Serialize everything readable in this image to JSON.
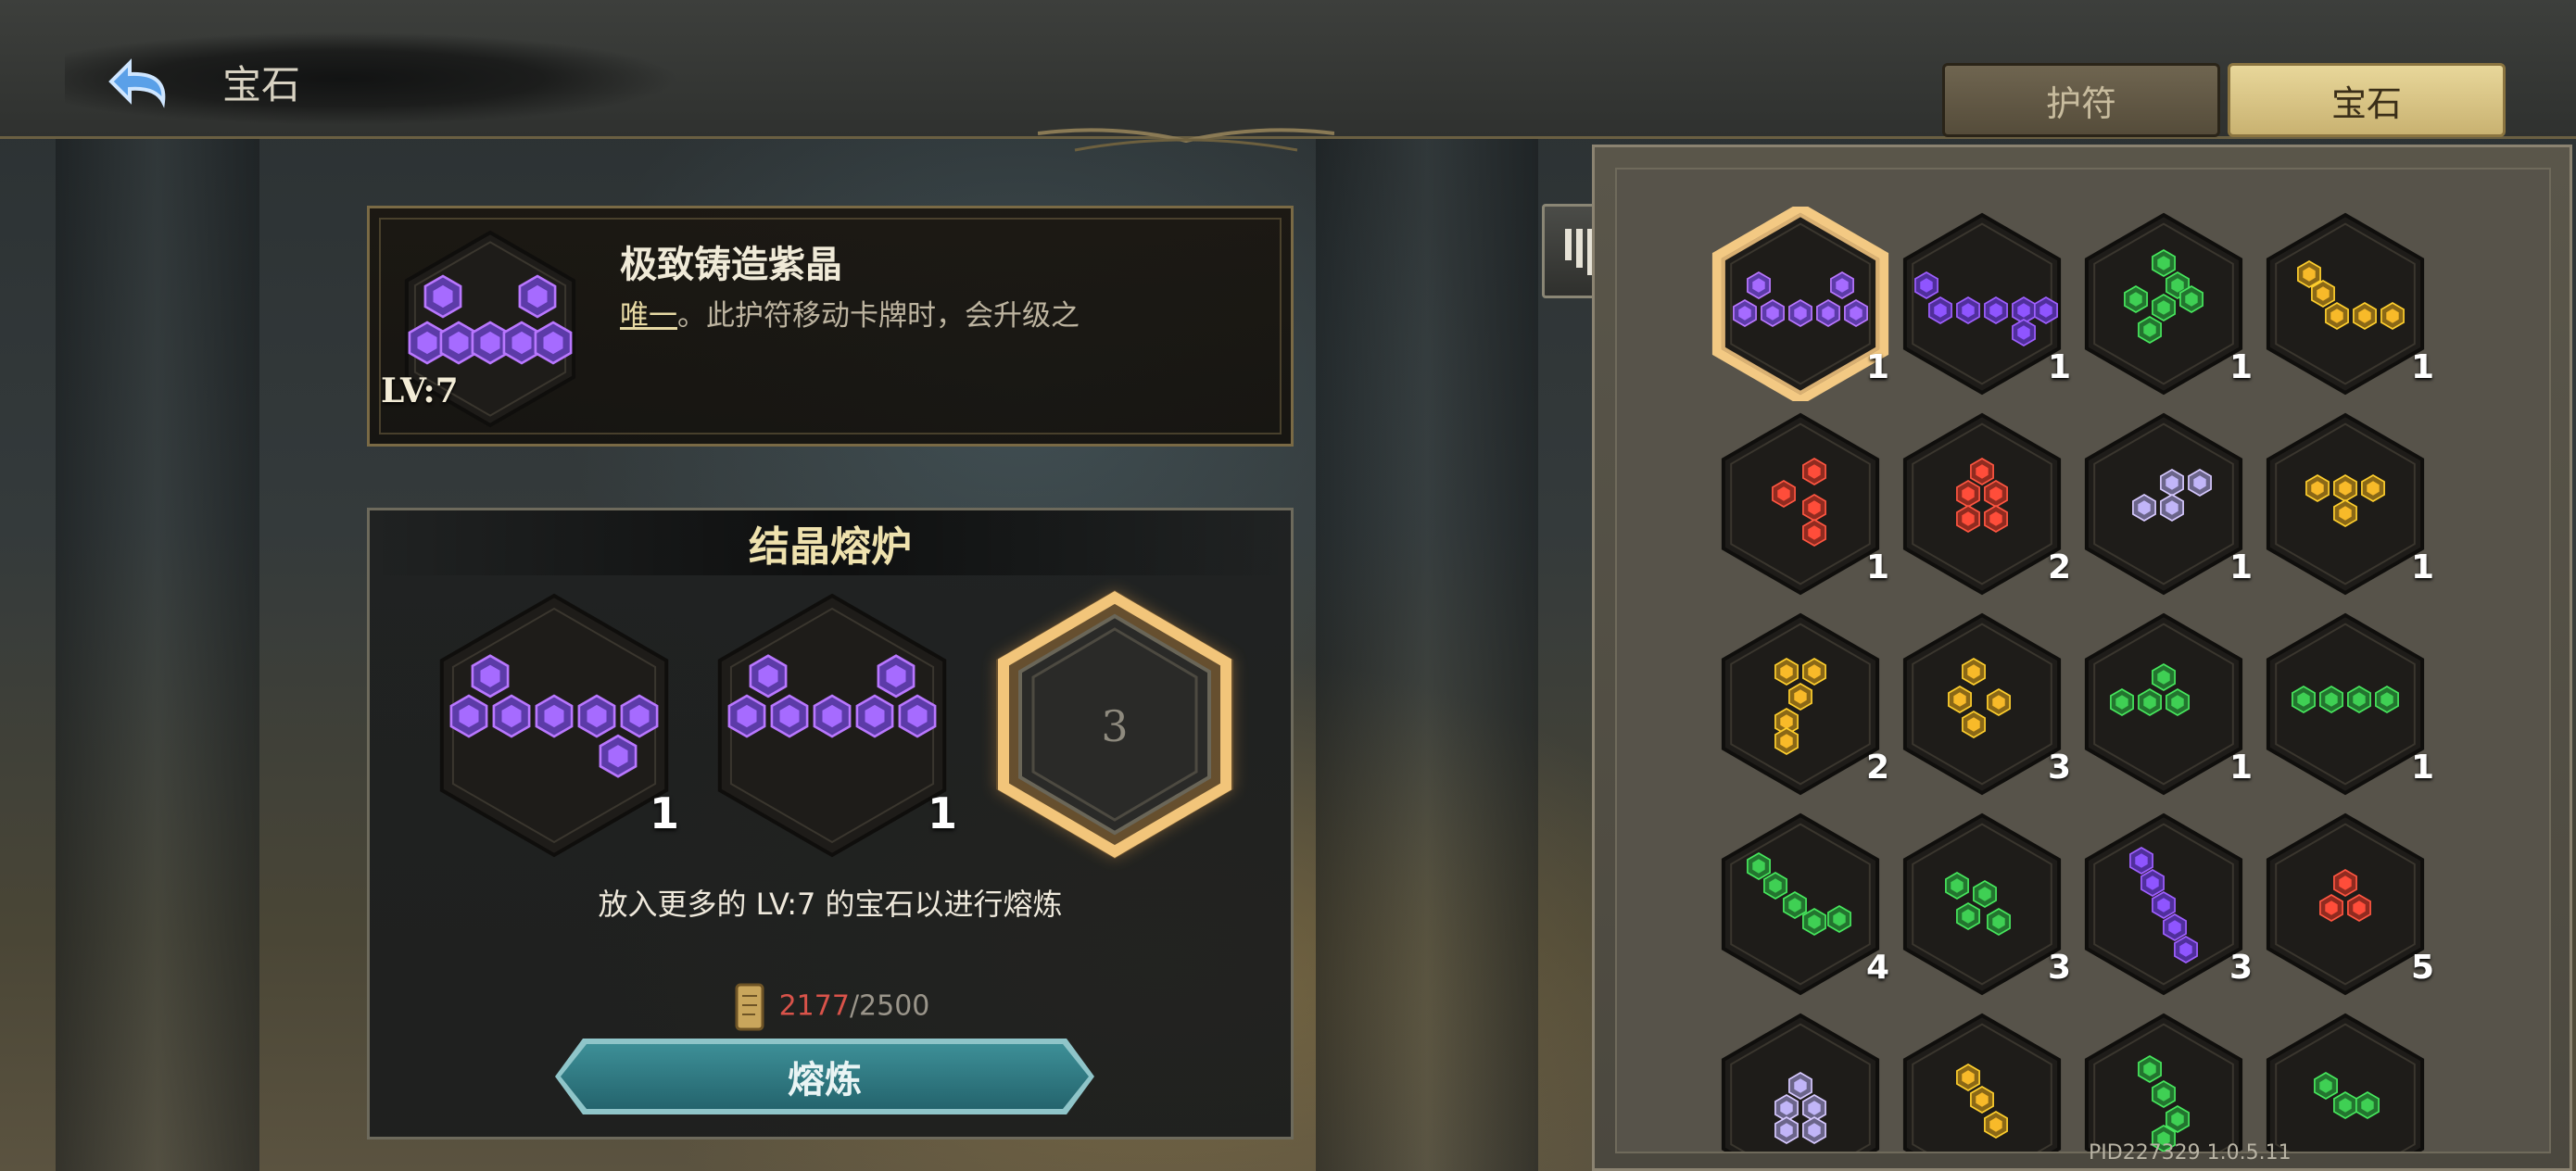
{
  "header": {
    "title": "宝石",
    "back_icon": "back-arrow-icon"
  },
  "tabs": [
    {
      "label": "护符",
      "active": false
    },
    {
      "label": "宝石",
      "active": true
    }
  ],
  "selected_gem": {
    "name": "极致铸造紫晶",
    "desc_keyword": "唯一",
    "desc_text": "。此护符移动卡牌时，会升级之",
    "level": "LV:7",
    "color": "#7b4fe0"
  },
  "furnace": {
    "title": "结晶熔炉",
    "slots": [
      {
        "count": "1",
        "color": "#7b4fe0",
        "filled": true
      },
      {
        "count": "1",
        "color": "#7b4fe0",
        "filled": true
      },
      {
        "count": "3",
        "filled": false
      }
    ],
    "hint": "放入更多的 LV:7 的宝石以进行熔炼",
    "cost_current": "2177",
    "cost_separator": "/",
    "cost_max": "2500",
    "button_label": "熔炼"
  },
  "inventory": {
    "items": [
      {
        "color": "#7b4fe0",
        "count": "1",
        "selected": true
      },
      {
        "color": "#6a3fd0",
        "count": "1"
      },
      {
        "color": "#2f9a3e",
        "count": "1"
      },
      {
        "color": "#b88a1e",
        "count": "1"
      },
      {
        "color": "#c0392b",
        "count": "1"
      },
      {
        "color": "#c0392b",
        "count": "2"
      },
      {
        "color": "#8f86b8",
        "count": "1"
      },
      {
        "color": "#b88a1e",
        "count": "1"
      },
      {
        "color": "#b88a1e",
        "count": "2"
      },
      {
        "color": "#b88a1e",
        "count": "3"
      },
      {
        "color": "#2f9a3e",
        "count": "1"
      },
      {
        "color": "#2f9a3e",
        "count": "1"
      },
      {
        "color": "#2f9a3e",
        "count": "4"
      },
      {
        "color": "#2f9a3e",
        "count": "3"
      },
      {
        "color": "#6a3fd0",
        "count": "3"
      },
      {
        "color": "#c0392b",
        "count": "5"
      },
      {
        "color": "#8f86b8",
        "count": ""
      },
      {
        "color": "#b88a1e",
        "count": ""
      },
      {
        "color": "#2f9a3e",
        "count": ""
      },
      {
        "color": "#2f9a3e",
        "count": ""
      }
    ]
  },
  "build_id": "PID227329  1.0.5.11"
}
